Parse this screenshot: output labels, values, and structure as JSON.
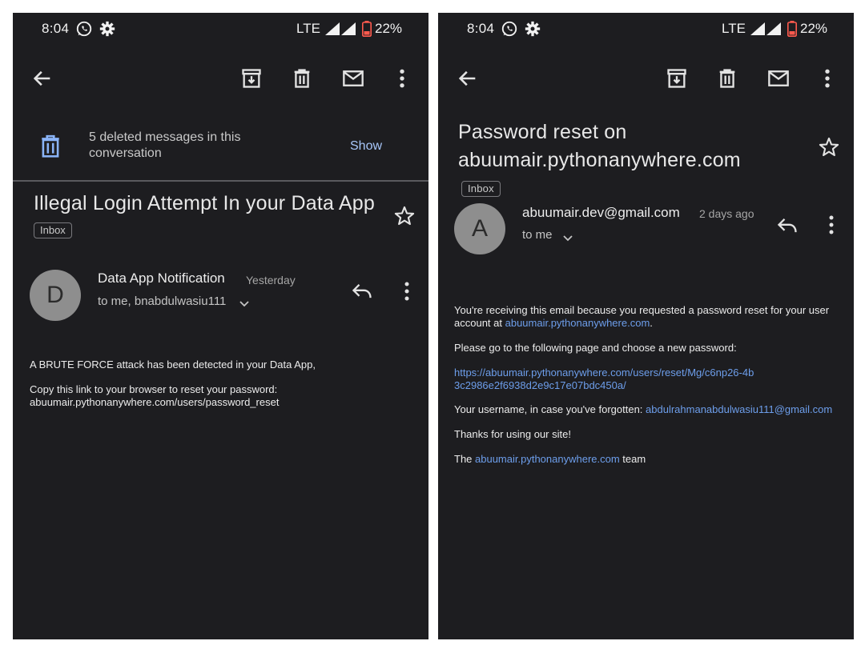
{
  "status": {
    "time": "8:04",
    "network": "LTE",
    "battery": "22%"
  },
  "left": {
    "deleted_banner": {
      "text": "5 deleted messages in this conversation",
      "action": "Show"
    },
    "subject": "Illegal Login Attempt In your Data App",
    "label": "Inbox",
    "sender": {
      "initial": "D",
      "name": "Data App Notification",
      "time": "Yesterday",
      "recipients": "to me, bnabdulwasiu111"
    },
    "body": {
      "line1": "A BRUTE FORCE attack has been detected in your Data App,",
      "line2": "Copy this link to your browser to reset your password:",
      "line3": "abuumair.pythonanywhere.com/users/password_reset"
    }
  },
  "right": {
    "subject": "Password reset on abuumair.pythonanywhere.com",
    "label": "Inbox",
    "sender": {
      "initial": "A",
      "name": "abuumair.dev@gmail.com",
      "time": "2 days ago",
      "recipients": "to me"
    },
    "body": {
      "p1_text": "You're receiving this email because you requested a password reset for your user account at ",
      "p1_link": "abuumair.pythonanywhere.com",
      "p1_end": ".",
      "p2": "Please go to the following page and choose a new password:",
      "p3_link_line1": "https://abuumair.pythonanywhere.com/users/reset/Mg/c6np26-4b",
      "p3_link_line2": "3c2986e2f6938d2e9c17e07bdc450a/",
      "p4_text": "Your username, in case you've forgotten: ",
      "p4_link": "abdulrahmanabdulwasiu111@gmail.com",
      "p5": "Thanks for using our site!",
      "p6_pre": "The ",
      "p6_link": "abuumair.pythonanywhere.com",
      "p6_post": " team"
    }
  },
  "icons": {
    "status_bar": [
      "whatsapp-icon",
      "gear-icon",
      "signal-icon",
      "battery-icon"
    ],
    "toolbar": [
      "back-arrow-icon",
      "archive-icon",
      "delete-icon",
      "mail-icon",
      "more-vert-icon"
    ],
    "message": [
      "star-icon",
      "reply-icon",
      "chevron-down-icon",
      "more-vert-icon"
    ],
    "colors": {
      "background": "#1d1d20",
      "link": "#6d9eeb",
      "show_action": "#a8c7fa",
      "deleted_icon": "#8ab4f8"
    }
  }
}
